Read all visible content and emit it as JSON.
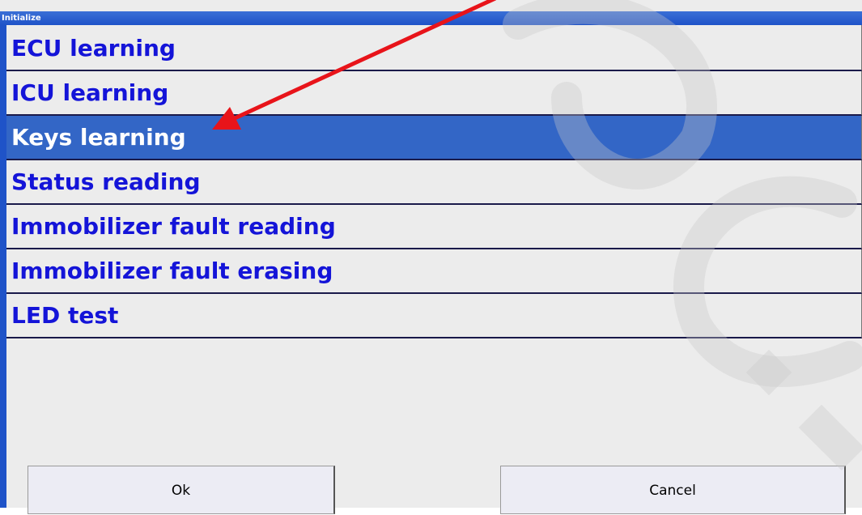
{
  "window": {
    "title": "Initialize"
  },
  "menu": {
    "items": [
      {
        "label": "ECU learning",
        "selected": false
      },
      {
        "label": "ICU learning",
        "selected": false
      },
      {
        "label": "Keys learning",
        "selected": true
      },
      {
        "label": "Status reading",
        "selected": false
      },
      {
        "label": "Immobilizer fault reading",
        "selected": false
      },
      {
        "label": "Immobilizer fault erasing",
        "selected": false
      },
      {
        "label": "LED test",
        "selected": false
      }
    ]
  },
  "buttons": {
    "ok_label": "Ok",
    "cancel_label": "Cancel"
  },
  "annotation": {
    "arrow_color": "#e8141a",
    "points_to": "Keys learning"
  },
  "colors": {
    "item_text": "#1414d8",
    "selected_bg": "#3366c6",
    "title_bar": "#1f53c8"
  }
}
